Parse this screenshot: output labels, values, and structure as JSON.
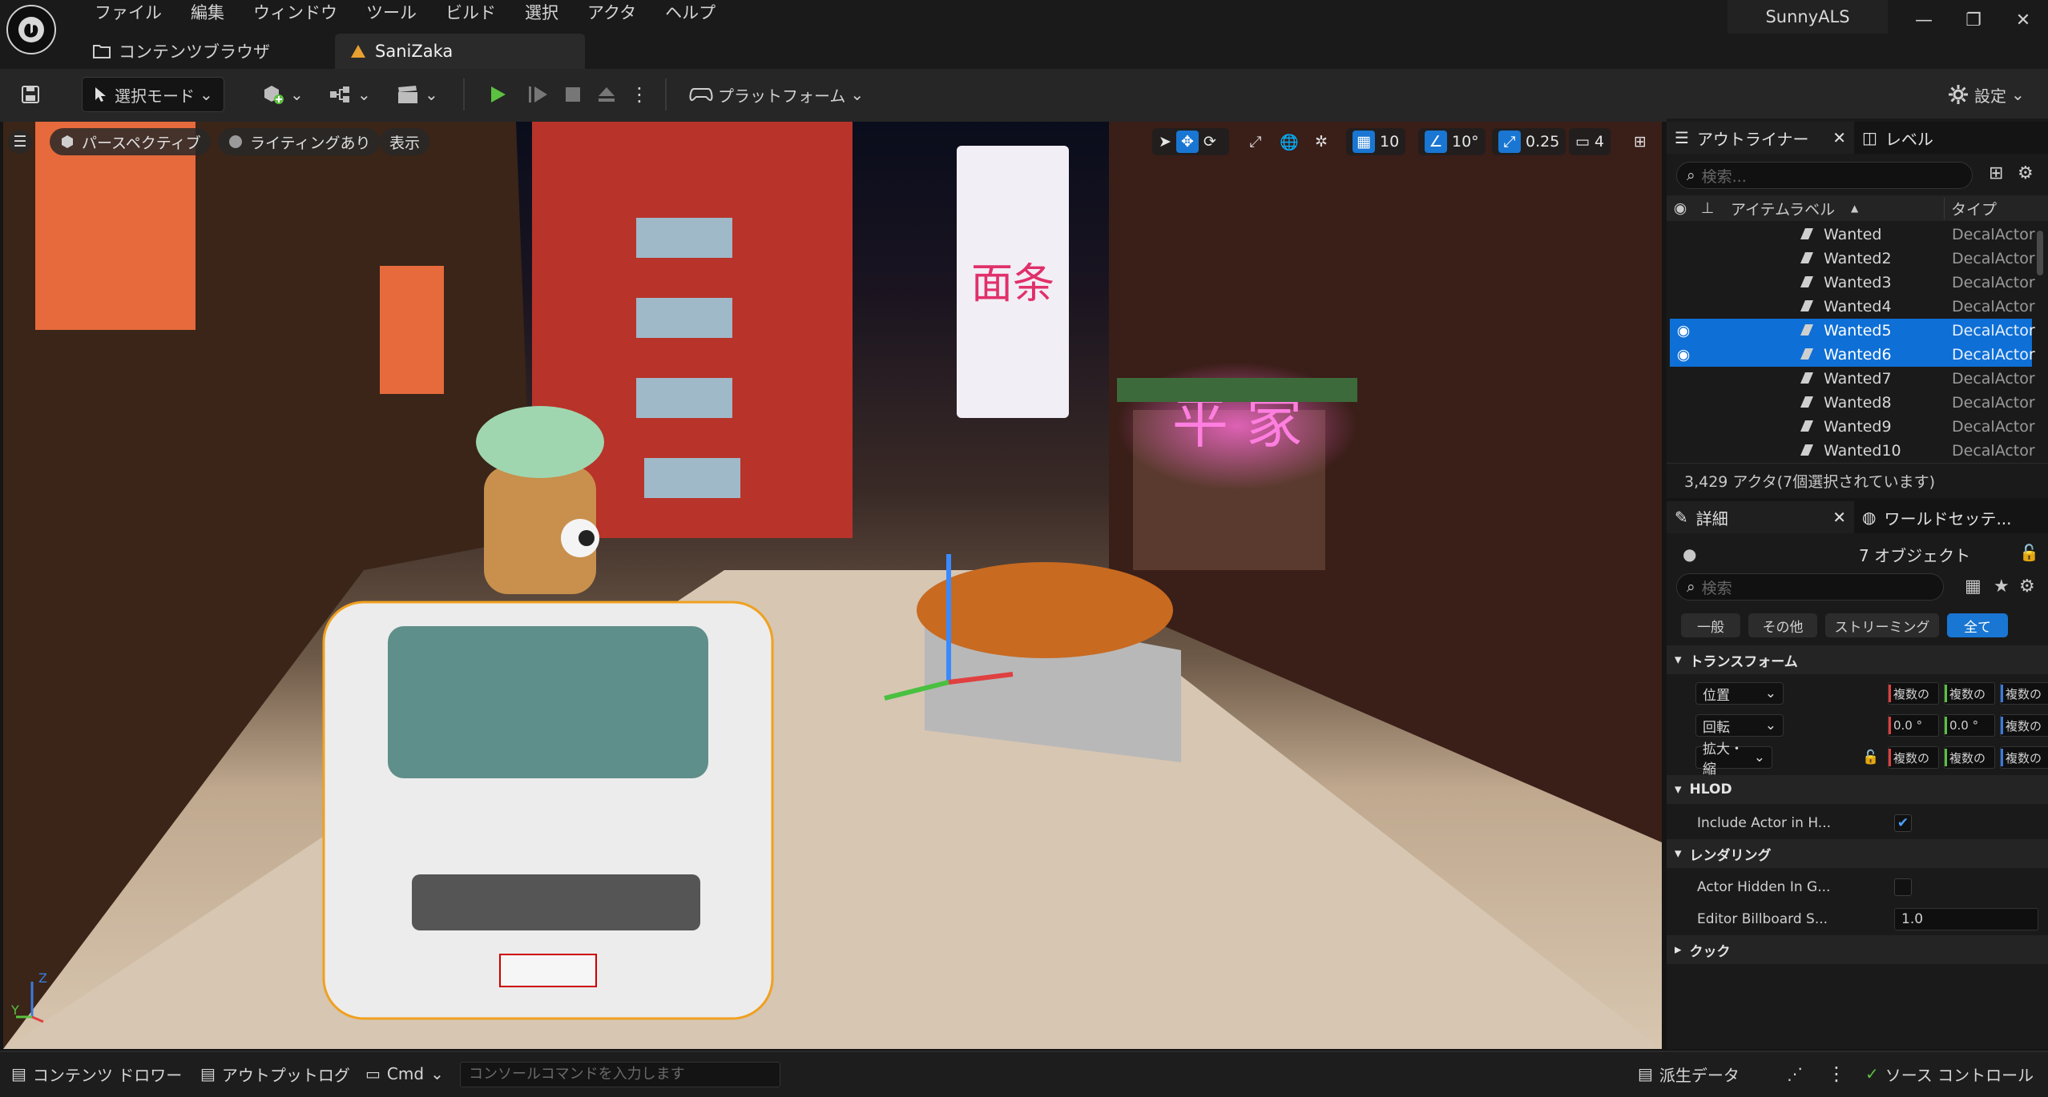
{
  "app": {
    "menu": [
      "ファイル",
      "編集",
      "ウィンドウ",
      "ツール",
      "ビルド",
      "選択",
      "アクタ",
      "ヘルプ"
    ],
    "tabs": [
      {
        "label": "コンテンツブラウザ",
        "icon": "folder-icon"
      },
      {
        "label": "SaniZaka",
        "icon": "level-icon"
      }
    ],
    "project_name": "SunnyALS",
    "window_buttons": [
      "minimize",
      "restore",
      "close"
    ]
  },
  "toolbar": {
    "mode_label": "選択モード",
    "platform_label": "プラットフォーム",
    "settings_label": "設定"
  },
  "viewport": {
    "perspective_label": "パースペクティブ",
    "lighting_label": "ライティングあり",
    "show_label": "表示",
    "grid_snap": "10",
    "rotation_snap": "10°",
    "scale_snap": "0.25",
    "camera_speed": "4",
    "axis_labels": {
      "z": "Z",
      "y": "Y"
    }
  },
  "outliner": {
    "tab_label": "アウトライナー",
    "levels_tab_label": "レベル",
    "search_placeholder": "検索...",
    "col_label": "アイテムラベル",
    "col_type": "タイプ",
    "rows": [
      {
        "name": "Wanted",
        "type": "DecalActor",
        "selected": false
      },
      {
        "name": "Wanted2",
        "type": "DecalActor",
        "selected": false
      },
      {
        "name": "Wanted3",
        "type": "DecalActor",
        "selected": false
      },
      {
        "name": "Wanted4",
        "type": "DecalActor",
        "selected": false
      },
      {
        "name": "Wanted5",
        "type": "DecalActor",
        "selected": true
      },
      {
        "name": "Wanted6",
        "type": "DecalActor",
        "selected": true
      },
      {
        "name": "Wanted7",
        "type": "DecalActor",
        "selected": false
      },
      {
        "name": "Wanted8",
        "type": "DecalActor",
        "selected": false
      },
      {
        "name": "Wanted9",
        "type": "DecalActor",
        "selected": false
      },
      {
        "name": "Wanted10",
        "type": "DecalActor",
        "selected": false
      }
    ],
    "status": "3,429 アクタ(7個選択されています)"
  },
  "details": {
    "tab_label": "詳細",
    "world_tab_label": "ワールドセッテ...",
    "object_count": "7 オブジェクト",
    "search_placeholder": "検索",
    "filters": [
      "一般",
      "その他",
      "ストリーミング",
      "全て"
    ],
    "transform": {
      "title": "トランスフォーム",
      "location_label": "位置",
      "rotation_label": "回転",
      "scale_label": "拡大・縮",
      "location": [
        "複数の",
        "複数の",
        "複数の"
      ],
      "rotation": [
        "0.0 °",
        "0.0 °",
        "複数の"
      ],
      "scale": [
        "複数の",
        "複数の",
        "複数の"
      ]
    },
    "hlod": {
      "title": "HLOD",
      "include_label": "Include Actor in H...",
      "include_checked": true
    },
    "rendering": {
      "title": "レンダリング",
      "hidden_label": "Actor Hidden In G...",
      "billboard_label": "Editor Billboard S...",
      "billboard_value": "1.0"
    },
    "cook": {
      "title": "クック"
    }
  },
  "statusbar": {
    "content_drawer": "コンテンツ ドロワー",
    "output_log": "アウトプットログ",
    "cmd": "Cmd",
    "console_placeholder": "コンソールコマンドを入力します",
    "derived_data": "派生データ",
    "source_control": "ソース コントロール"
  },
  "colors": {
    "accent": "#1976d2",
    "selection": "#0e6fd6",
    "play": "#5cc040"
  }
}
